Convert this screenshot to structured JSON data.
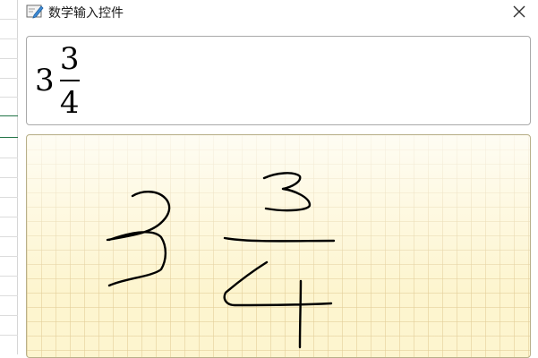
{
  "window": {
    "title": "数学输入控件",
    "app_icon": "math-input-panel-icon",
    "close_icon": "close-icon"
  },
  "preview": {
    "whole": "3",
    "numerator": "3",
    "denominator": "4"
  },
  "ink_pad": {
    "grid_color": "#e2cd96",
    "background_color": "#fdf5cf",
    "stroke_color": "#000000"
  }
}
